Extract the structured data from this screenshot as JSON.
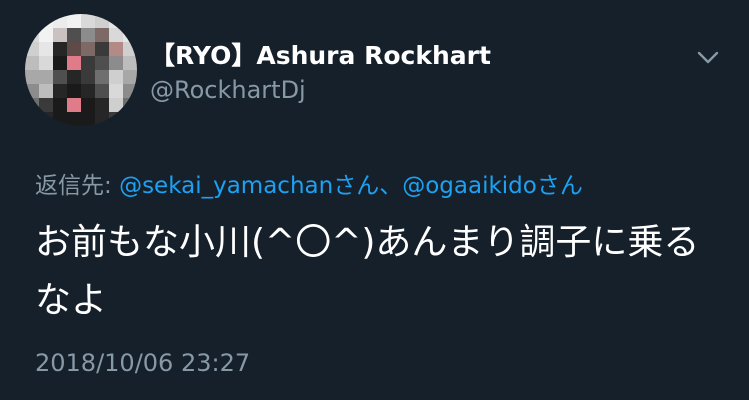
{
  "user": {
    "display_name": "【RYO】Ashura Rockhart",
    "handle": "@RockhartDj"
  },
  "reply": {
    "prefix": "返信先: ",
    "mentions": [
      "@sekai_yamachan",
      "@ogaaikido"
    ],
    "suffix_1": "さん、",
    "suffix_2": "さん"
  },
  "tweet": {
    "text": "お前もな小川(^〇^)あんまり調子に乗るなよ",
    "timestamp": "2018/10/06 23:27"
  },
  "icons": {
    "menu": "chevron-down-icon",
    "avatar": "pixelated-avatar"
  },
  "colors": {
    "background": "#15202b",
    "primary_text": "#ffffff",
    "secondary_text": "#8899a6",
    "link": "#1da1f2"
  }
}
